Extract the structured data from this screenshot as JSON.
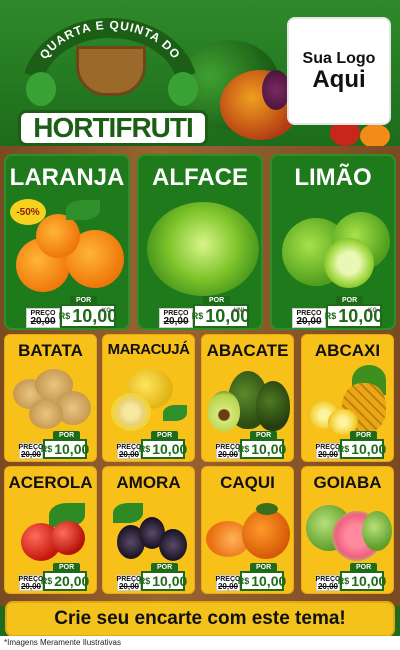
{
  "header": {
    "arc_title": "QUARTA E QUINTA DO",
    "brand": "HORTIFRUTI",
    "logo_line1": "Sua Logo",
    "logo_line2": "Aqui"
  },
  "big_items": [
    {
      "name": "LARANJA",
      "badge": "-50%",
      "old_label": "PREÇO",
      "old_price": "20,00",
      "por": "POR",
      "currency": "R$",
      "price": "10,00",
      "unit": "KG"
    },
    {
      "name": "ALFACE",
      "old_label": "PREÇO",
      "old_price": "20,00",
      "por": "POR",
      "currency": "R$",
      "price": "10,00",
      "unit": "UNI"
    },
    {
      "name": "LIMÃO",
      "old_label": "PREÇO",
      "old_price": "20,00",
      "por": "POR",
      "currency": "R$",
      "price": "10,00",
      "unit": "KG"
    }
  ],
  "small_items": [
    {
      "name": "BATATA",
      "old_label": "PREÇO",
      "old_price": "20,00",
      "por": "POR",
      "currency": "R$",
      "price": "10,00"
    },
    {
      "name": "MARACUJÁ",
      "old_label": "PREÇO",
      "old_price": "20,00",
      "por": "POR",
      "currency": "R$",
      "price": "10,00"
    },
    {
      "name": "ABACATE",
      "old_label": "PREÇO",
      "old_price": "20,00",
      "por": "POR",
      "currency": "R$",
      "price": "10,00"
    },
    {
      "name": "ABCAXI",
      "old_label": "PREÇO",
      "old_price": "20,00",
      "por": "POR",
      "currency": "R$",
      "price": "10,00"
    },
    {
      "name": "ACEROLA",
      "old_label": "PREÇO",
      "old_price": "20,00",
      "por": "POR",
      "currency": "R$",
      "price": "20,00"
    },
    {
      "name": "AMORA",
      "old_label": "PREÇO",
      "old_price": "20,00",
      "por": "POR",
      "currency": "R$",
      "price": "10,00"
    },
    {
      "name": "CAQUI",
      "old_label": "PREÇO",
      "old_price": "20,00",
      "por": "POR",
      "currency": "R$",
      "price": "10,00"
    },
    {
      "name": "GOIABA",
      "old_label": "PREÇO",
      "old_price": "20,00",
      "por": "POR",
      "currency": "R$",
      "price": "10,00"
    }
  ],
  "footer": {
    "cta": "Crie seu encarte com este tema!"
  },
  "disclaimer": "*Imagens Meramente Ilustrativas",
  "colors": {
    "green": "#1f7a1c",
    "yellow": "#f7c11a",
    "wood": "#8a5a2a"
  }
}
